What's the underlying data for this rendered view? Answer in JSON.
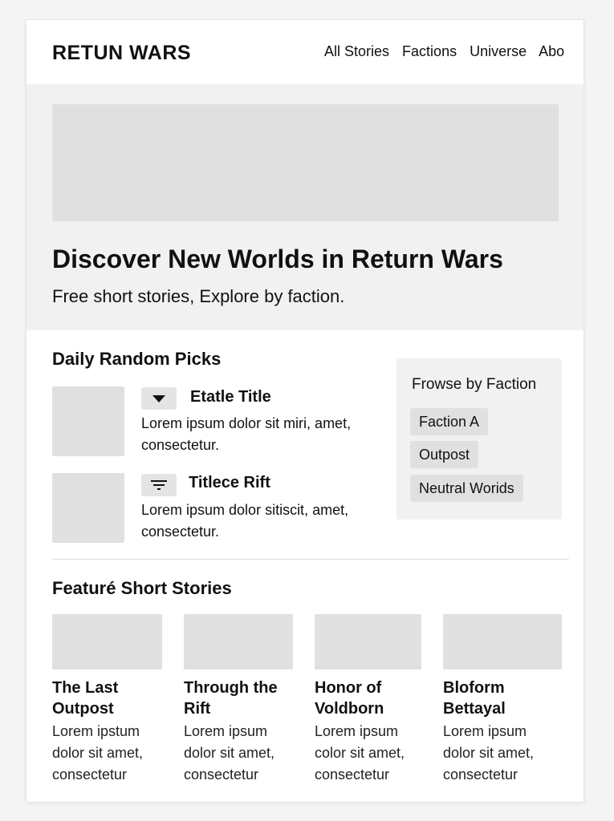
{
  "header": {
    "logo": "RETUN WARS",
    "nav": [
      "All Stories",
      "Factions",
      "Universe",
      "Abo"
    ]
  },
  "hero": {
    "title": "Discover New Worlds in Return Wars",
    "subtitle": "Free short stories, Explore by faction."
  },
  "daily": {
    "title": "Daily Random Picks",
    "items": [
      {
        "icon": "dropdown-triangle-icon",
        "title": "Etatle Title",
        "desc": "Lorem ipsum dolor sit miri, amet, consectetur."
      },
      {
        "icon": "filter-icon",
        "title": "Titlece Rift",
        "desc": "Lorem ipsum dolor sitiscit, amet, consectetur."
      }
    ]
  },
  "factions": {
    "title": "Frowse by Faction",
    "chips": [
      "Faction A",
      "Outpost",
      "Neutral Worids"
    ]
  },
  "featured": {
    "title": "Featuré Short Stories",
    "stories": [
      {
        "title": "The Last Outpost",
        "desc": "Lorem ipstum dolor sit amet, consectetur"
      },
      {
        "title": "Through the Rift",
        "desc": "Lorem ipsum dolor sit amet, consectetur"
      },
      {
        "title": "Honor of Voldborn",
        "desc": "Lorem ipsum color sit amet, consectetur"
      },
      {
        "title": "Bloform Bettayal",
        "desc": "Lorem ipsum dolor sit amet, consectetur"
      }
    ]
  },
  "colors": {
    "page_bg": "#f4f4f4",
    "panel_bg": "#f1f1f1",
    "placeholder": "#e0e0e0",
    "text": "#111111"
  }
}
